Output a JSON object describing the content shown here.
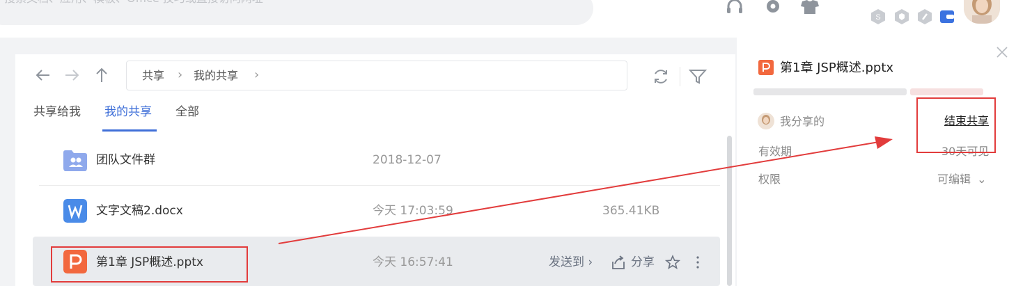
{
  "search": {
    "placeholder": "搜索文档、应用、模板、Office 技巧或直接访问网址"
  },
  "header_icons": [
    "headset-icon",
    "gear-icon",
    "tshirt-icon"
  ],
  "breadcrumb": {
    "items": [
      "共享",
      "我的共享"
    ]
  },
  "tabs": [
    {
      "label": "共享给我",
      "active": false
    },
    {
      "label": "我的共享",
      "active": true
    },
    {
      "label": "全部",
      "active": false
    }
  ],
  "files": [
    {
      "name": "团队文件群",
      "date": "2018-12-07",
      "size": "",
      "icon": "group-folder-icon",
      "color": "#8fa9ec"
    },
    {
      "name": "文字文稿2.docx",
      "date": "今天 17:03:59",
      "size": "365.41KB",
      "icon": "word-doc-icon",
      "color": "#4a8be8"
    },
    {
      "name": "第1章 JSP概述.pptx",
      "date": "今天 16:57:41",
      "size": "",
      "icon": "ppt-icon",
      "color": "#f2683e",
      "selected": true
    }
  ],
  "row_actions": {
    "send_to": "发送到",
    "share": "分享"
  },
  "detail": {
    "title": "第1章 JSP概述.pptx",
    "shared_by": "我分享的",
    "end_share": "结束共享",
    "validity_label": "有效期",
    "validity_value": "30天可见",
    "permission_label": "权限",
    "permission_value": "可编辑"
  },
  "colors": {
    "accent": "#3f6fd8",
    "annotation": "#e23c3c",
    "ppt": "#f2683e"
  }
}
